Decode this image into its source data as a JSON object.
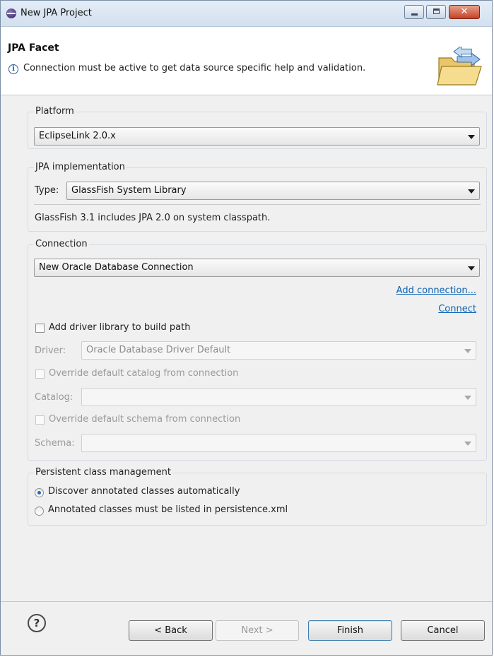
{
  "window": {
    "title": "New JPA Project"
  },
  "header": {
    "title": "JPA Facet",
    "message": "Connection must be active to get data source specific help and validation."
  },
  "platform": {
    "legend": "Platform",
    "selected": "EclipseLink 2.0.x"
  },
  "jpa_impl": {
    "legend": "JPA implementation",
    "type_label": "Type:",
    "type_value": "GlassFish System Library",
    "note": "GlassFish 3.1 includes JPA 2.0 on system classpath."
  },
  "connection": {
    "legend": "Connection",
    "selected": "New Oracle Database Connection",
    "add_connection": "Add connection...",
    "connect": "Connect",
    "add_driver_label": "Add driver library to build path",
    "driver_label": "Driver:",
    "driver_value": "Oracle Database Driver Default",
    "override_catalog_label": "Override default catalog from connection",
    "catalog_label": "Catalog:",
    "catalog_value": "",
    "override_schema_label": "Override default schema from connection",
    "schema_label": "Schema:",
    "schema_value": ""
  },
  "persistence": {
    "legend": "Persistent class management",
    "option_discover": "Discover annotated classes automatically",
    "option_listed": "Annotated classes must be listed in persistence.xml",
    "selected": "discover"
  },
  "buttons": {
    "back": "< Back",
    "next": "Next >",
    "finish": "Finish",
    "cancel": "Cancel"
  },
  "colors": {
    "link": "#0b63b6",
    "dialog_bg": "#f0f0f0",
    "close_button": "#c64127"
  }
}
